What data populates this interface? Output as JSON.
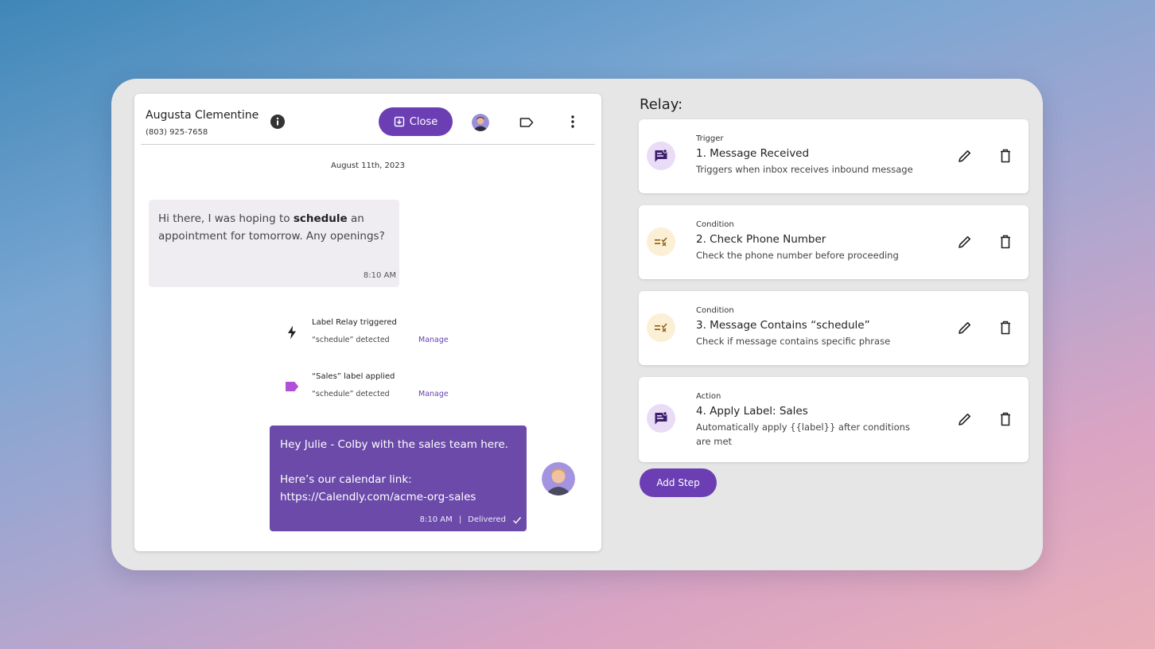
{
  "chat": {
    "contact_name": "Augusta Clementine",
    "contact_phone": "(803) 925-7658",
    "close_label": "Close",
    "date": "August 11th, 2023",
    "incoming": {
      "before": "Hi there, I was hoping to ",
      "bold": "schedule",
      "after": " an appointment for tomorrow. Any openings?",
      "time": "8:10 AM"
    },
    "events": [
      {
        "title": "Label Relay triggered",
        "sub": "“schedule” detected",
        "link": "Manage",
        "icon": "bolt-icon"
      },
      {
        "title": "“Sales” label applied",
        "sub": "“schedule” detected",
        "link": "Manage",
        "icon": "label-tag-icon",
        "color": "#b14fd8"
      }
    ],
    "outgoing": {
      "line1": "Hey Julie - Colby with the sales team here.",
      "line2": "Here’s our calendar link:",
      "line3": "https://Calendly.com/acme-org-sales",
      "time": "8:10 AM",
      "status": "Delivered"
    }
  },
  "relay": {
    "title": "Relay:",
    "steps": [
      {
        "type": "Trigger",
        "title": "1. Message Received",
        "desc": "Triggers when inbox receives inbound message",
        "icon": "message-icon"
      },
      {
        "type": "Condition",
        "title": "2. Check Phone Number",
        "desc": "Check the phone number before proceeding",
        "icon": "condition-icon"
      },
      {
        "type": "Condition",
        "title": "3. Message Contains “schedule”",
        "desc": "Check if message contains specific phrase",
        "icon": "condition-icon"
      },
      {
        "type": "Action",
        "title": "4. Apply Label: Sales",
        "desc": "Automatically apply {{label}} after conditions are met",
        "icon": "message-icon"
      }
    ],
    "add_step_label": "Add Step"
  },
  "colors": {
    "accent": "#6b3fb3",
    "outgoing_bubble": "#6b4aa9",
    "trigger_icon_bg": "#eadcf7",
    "condition_icon_bg": "#fbf0d6"
  }
}
